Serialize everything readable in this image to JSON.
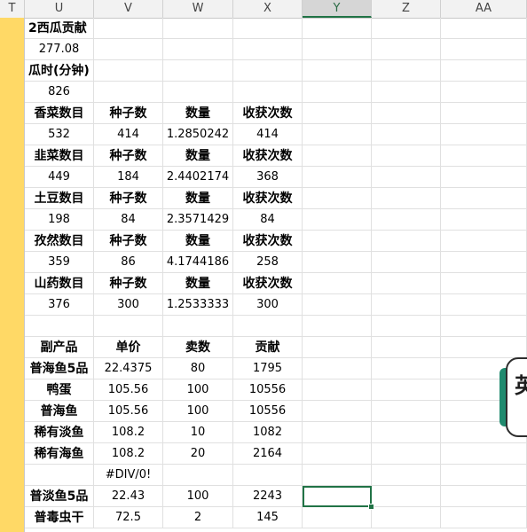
{
  "columns": [
    "T",
    "U",
    "V",
    "W",
    "X",
    "Y",
    "Z",
    "AA"
  ],
  "selected_column": "Y",
  "rows": [
    [
      "2西瓜贡献",
      "",
      "",
      ""
    ],
    [
      "277.08",
      "",
      "",
      ""
    ],
    [
      "瓜时(分钟)",
      "",
      "",
      ""
    ],
    [
      "826",
      "",
      "",
      ""
    ],
    [
      "香菜数目",
      "种子数",
      "数量",
      "收获次数"
    ],
    [
      "532",
      "414",
      "1.2850242",
      "414"
    ],
    [
      "韭菜数目",
      "种子数",
      "数量",
      "收获次数"
    ],
    [
      "449",
      "184",
      "2.4402174",
      "368"
    ],
    [
      "土豆数目",
      "种子数",
      "数量",
      "收获次数"
    ],
    [
      "198",
      "84",
      "2.3571429",
      "84"
    ],
    [
      "孜然数目",
      "种子数",
      "数量",
      "收获次数"
    ],
    [
      "359",
      "86",
      "4.1744186",
      "258"
    ],
    [
      "山药数目",
      "种子数",
      "数量",
      "收获次数"
    ],
    [
      "376",
      "300",
      "1.2533333",
      "300"
    ],
    [
      "",
      "",
      "",
      ""
    ],
    [
      "副产品",
      "单价",
      "卖数",
      "贡献"
    ],
    [
      "普海鱼5品",
      "22.4375",
      "80",
      "1795"
    ],
    [
      "鸭蛋",
      "105.56",
      "100",
      "10556"
    ],
    [
      "普海鱼",
      "105.56",
      "100",
      "10556"
    ],
    [
      "稀有淡鱼",
      "108.2",
      "10",
      "1082"
    ],
    [
      "稀有海鱼",
      "108.2",
      "20",
      "2164"
    ],
    [
      "",
      "#DIV/0!",
      "",
      ""
    ],
    [
      "普淡鱼5品",
      "22.43",
      "100",
      "2243"
    ],
    [
      "普毒虫干",
      "72.5",
      "2",
      "145"
    ]
  ],
  "widget": {
    "glyph": "英",
    "icon": "floating-ime-widget"
  },
  "colors": {
    "frozen_column": "#ffd966",
    "selection": "#217346",
    "widget_tab": "#1f8a6e"
  }
}
